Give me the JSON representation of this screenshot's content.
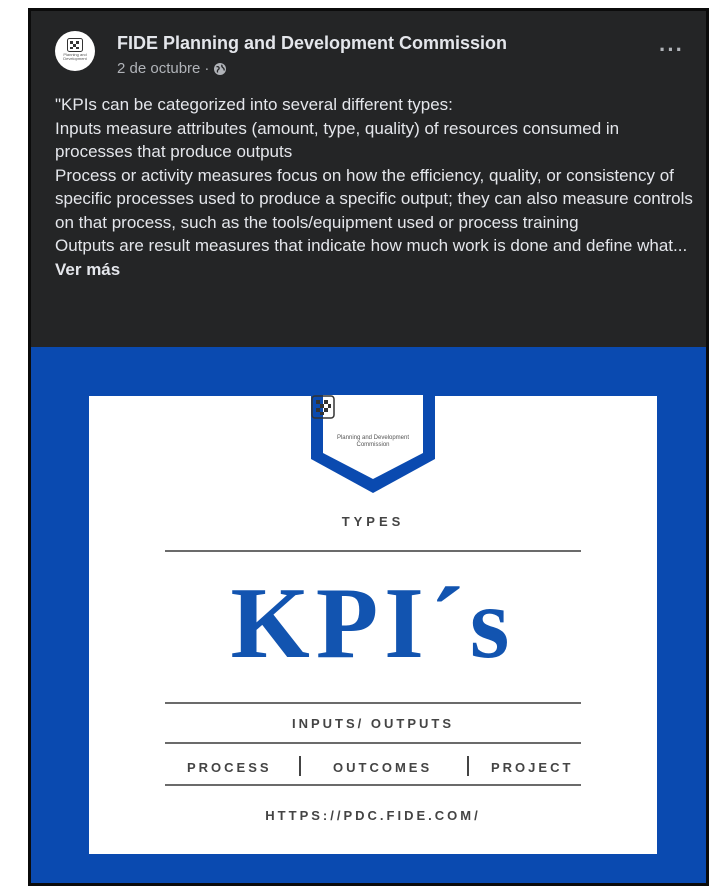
{
  "post": {
    "page_name": "FIDE Planning and Development Commission",
    "date": "2 de octubre",
    "date_separator": "·",
    "privacy_icon": "globe-icon",
    "more_icon": "more-options-icon",
    "caption": [
      "\"KPIs can be categorized into several different types:",
      "Inputs measure attributes (amount, type, quality) of resources consumed in processes that produce outputs",
      "Process or activity measures focus on how the efficiency, quality, or consistency of specific processes used to produce a specific output; they can also measure controls on that process, such as the tools/equipment used or process training",
      "Outputs are result measures that indicate how much work is done and define what..."
    ],
    "see_more": "Ver más",
    "avatar_text": "Planning and Development"
  },
  "image": {
    "ribbon_text": "Planning and Development Commission",
    "types": "TYPES",
    "title": "KPI´s",
    "inputs_outputs": "INPUTS/ OUTPUTS",
    "process": "PROCESS",
    "outcomes": "OUTCOMES",
    "project": "PROJECT",
    "url": "HTTPS://PDC.FIDE.COM/"
  },
  "colors": {
    "post_bg": "#242526",
    "text_primary": "#e4e6eb",
    "text_secondary": "#b0b3b8",
    "brand_blue": "#0a4ab0",
    "kpi_blue": "#1254b0"
  }
}
